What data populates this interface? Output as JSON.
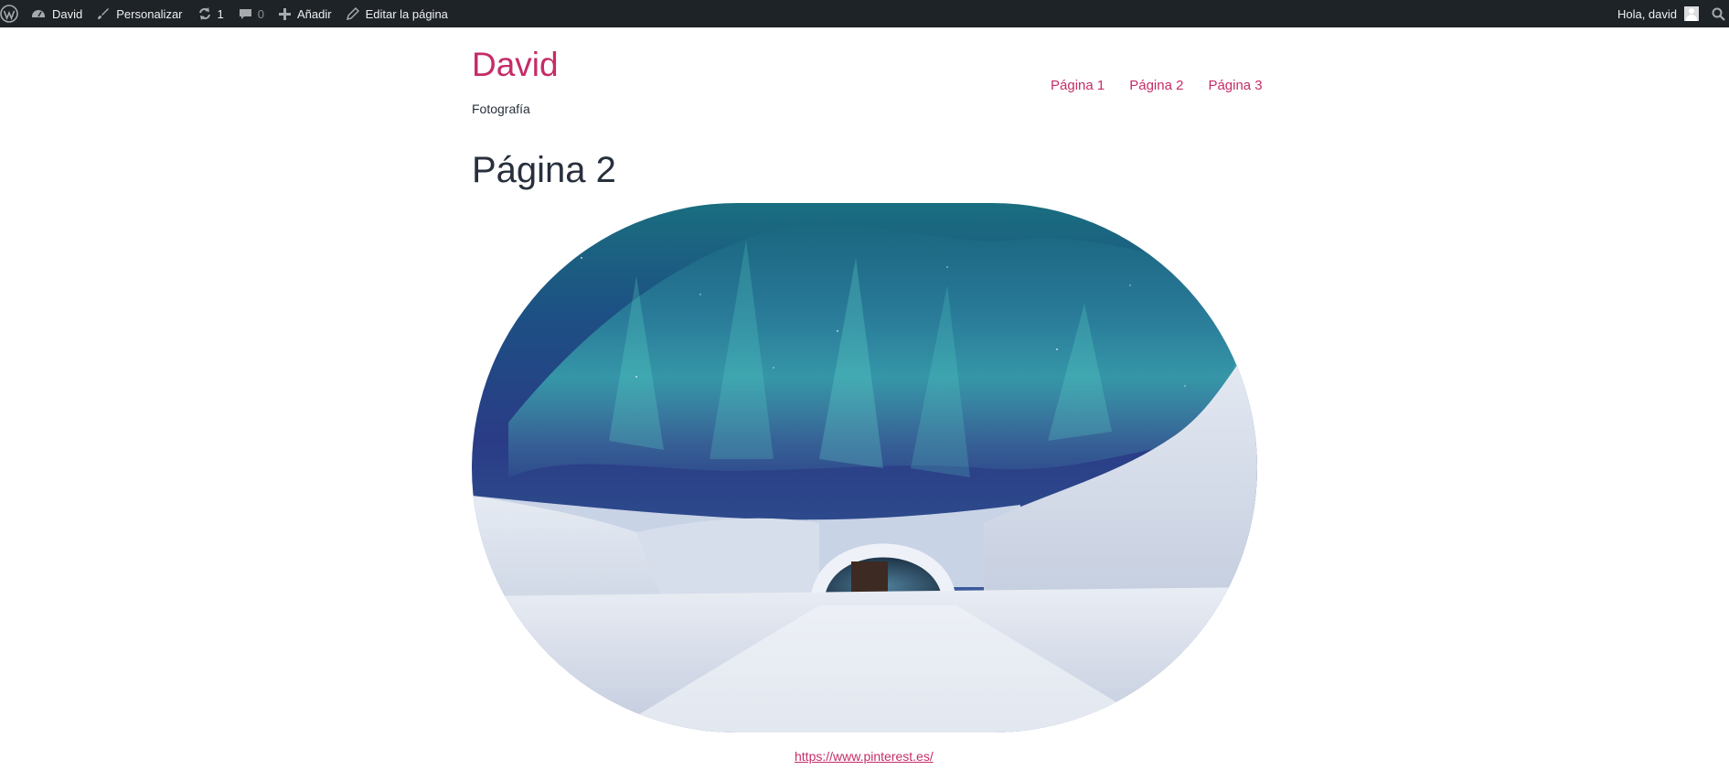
{
  "admin_bar": {
    "site_name": "David",
    "customize": "Personalizar",
    "updates_count": "1",
    "comments_count": "0",
    "add_new": "Añadir",
    "edit_page": "Editar la página",
    "greeting": "Hola, david"
  },
  "site": {
    "title": "David",
    "tagline": "Fotografía"
  },
  "nav": {
    "items": [
      {
        "label": "Página 1"
      },
      {
        "label": "Página 2"
      },
      {
        "label": "Página 3"
      }
    ]
  },
  "page": {
    "title": "Página 2",
    "link_text": "https://www.pinterest.es/"
  },
  "colors": {
    "admin_bar_bg": "#1d2327",
    "accent": "#c52c68",
    "text": "#28303d"
  },
  "icons": [
    "wordpress-icon",
    "dashboard-icon",
    "brush-icon",
    "updates-icon",
    "comment-icon",
    "plus-icon",
    "pencil-icon",
    "avatar-icon",
    "search-icon"
  ]
}
